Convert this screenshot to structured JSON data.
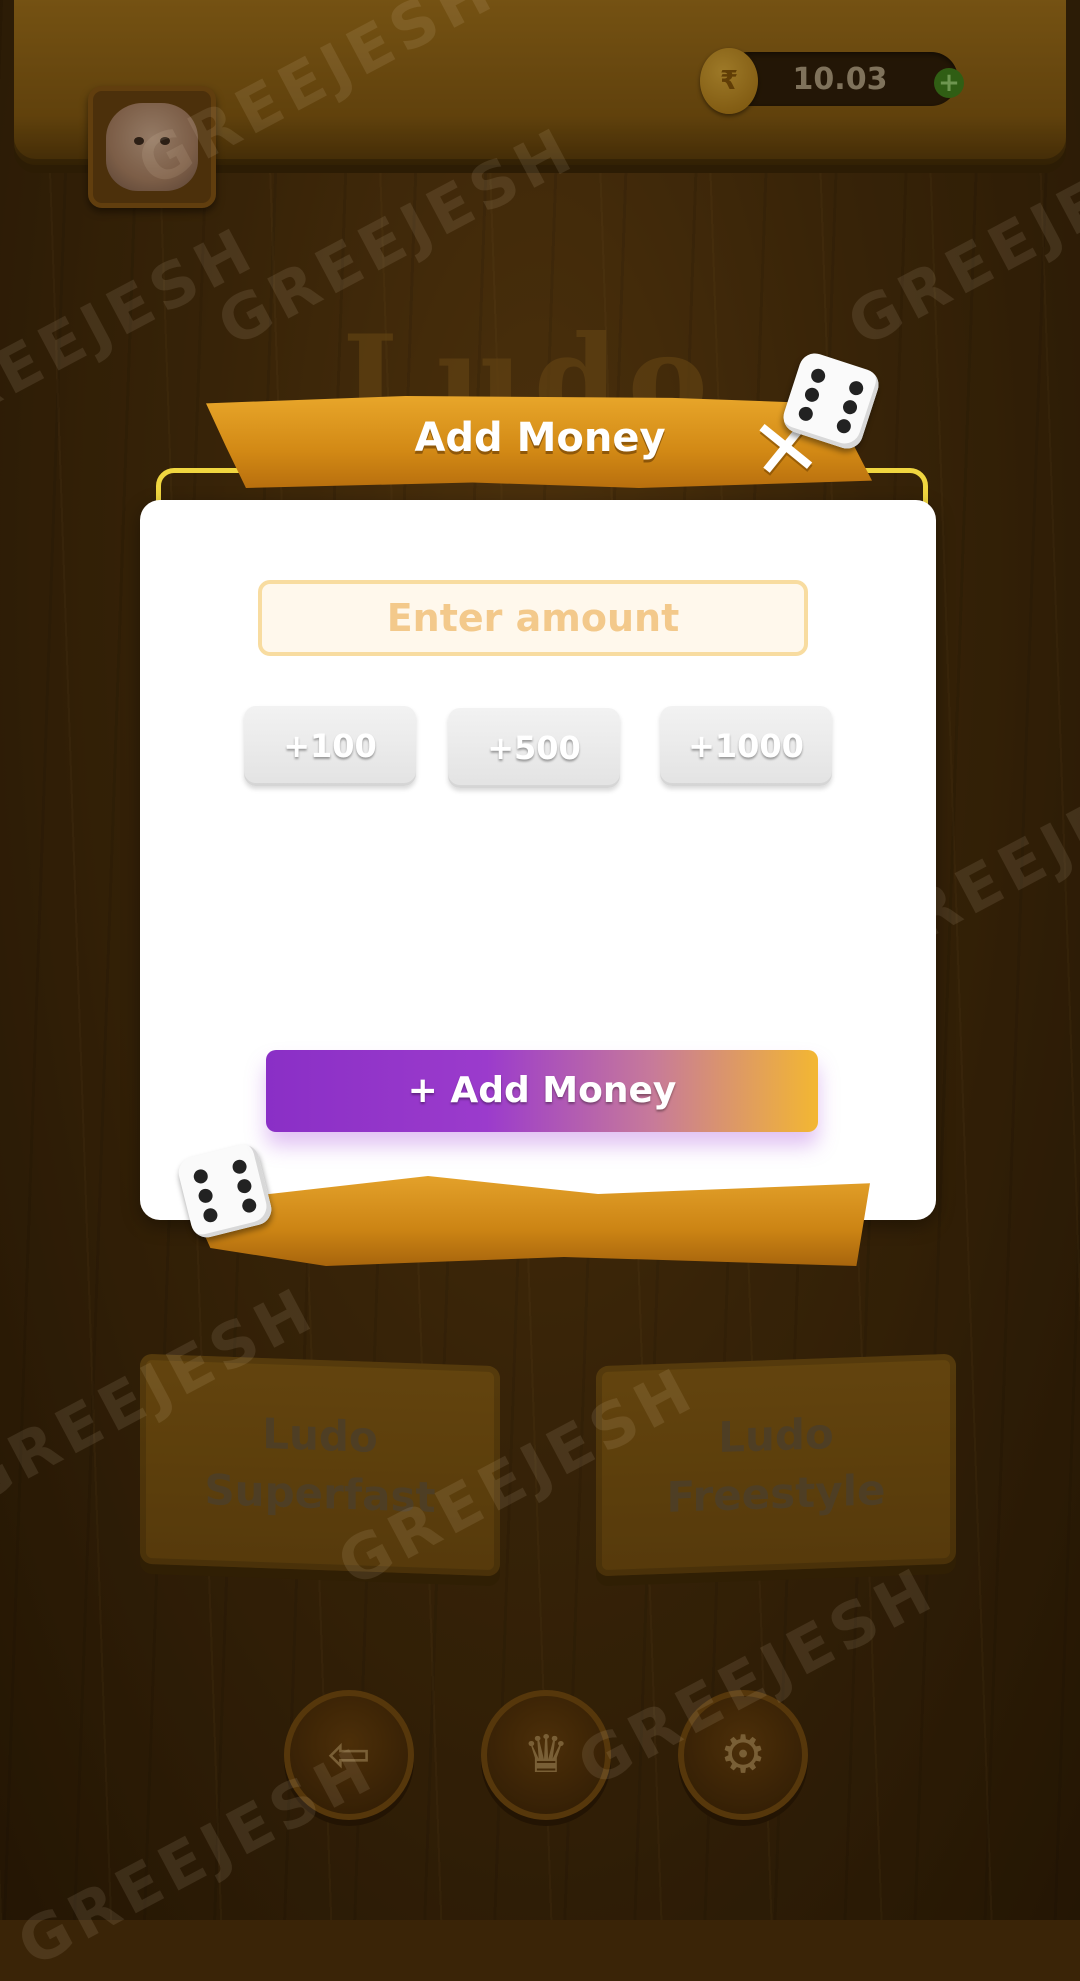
{
  "header": {
    "balance": "10.03",
    "add_balance_label": "+"
  },
  "background": {
    "logo_text": "Ludo",
    "modes": [
      {
        "line1": "Ludo",
        "line2": "Superfast"
      },
      {
        "line1": "Ludo",
        "line2": "Freestyle"
      }
    ],
    "nav_icons": [
      "exit-icon",
      "trophy-icon",
      "settings-icon"
    ],
    "watermark": "GREEJESH"
  },
  "modal": {
    "title": "Add Money",
    "close_label": "✕",
    "amount_placeholder": "Enter amount",
    "amount_value": "",
    "quick_amounts": [
      "+100",
      "+500",
      "+1000"
    ],
    "submit_label": "+ Add Money"
  },
  "colors": {
    "accent_purple": "#8a2fc6",
    "accent_gold": "#f3b732",
    "frame_yellow": "#f0d640"
  }
}
